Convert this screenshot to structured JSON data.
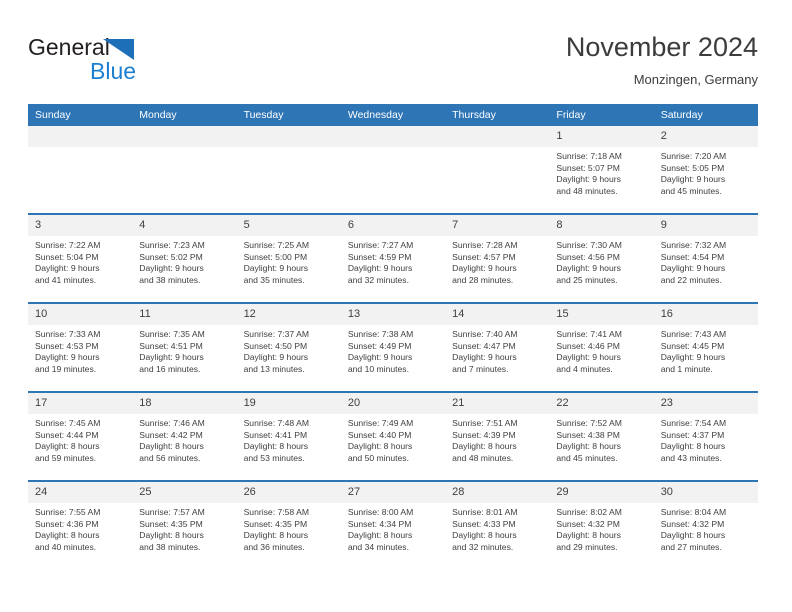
{
  "brand": {
    "word1": "General",
    "word2": "Blue",
    "mark": "triangle-icon",
    "colors": {
      "dark": "#231f20",
      "blue": "#1d7fd0",
      "mark": "#1d6fb8"
    }
  },
  "header": {
    "title": "November 2024",
    "subtitle": "Monzingen, Germany"
  },
  "theme": {
    "header_bg": "#2e75b6",
    "header_text": "#ffffff",
    "daynum_bg": "#f2f2f2",
    "body_text": "#404040",
    "row_divider": "#2e75b6"
  },
  "weekday_headers": [
    "Sunday",
    "Monday",
    "Tuesday",
    "Wednesday",
    "Thursday",
    "Friday",
    "Saturday"
  ],
  "labels": {
    "sunrise_prefix": "Sunrise: ",
    "sunset_prefix": "Sunset: ",
    "daylight_prefix": "Daylight: "
  },
  "weeks": [
    [
      {
        "day": "",
        "blank": true
      },
      {
        "day": "",
        "blank": true
      },
      {
        "day": "",
        "blank": true
      },
      {
        "day": "",
        "blank": true
      },
      {
        "day": "",
        "blank": true
      },
      {
        "day": "1",
        "sunrise": "Sunrise: 7:18 AM",
        "sunset": "Sunset: 5:07 PM",
        "daylight_l1": "Daylight: 9 hours",
        "daylight_l2": "and 48 minutes."
      },
      {
        "day": "2",
        "sunrise": "Sunrise: 7:20 AM",
        "sunset": "Sunset: 5:05 PM",
        "daylight_l1": "Daylight: 9 hours",
        "daylight_l2": "and 45 minutes."
      }
    ],
    [
      {
        "day": "3",
        "sunrise": "Sunrise: 7:22 AM",
        "sunset": "Sunset: 5:04 PM",
        "daylight_l1": "Daylight: 9 hours",
        "daylight_l2": "and 41 minutes."
      },
      {
        "day": "4",
        "sunrise": "Sunrise: 7:23 AM",
        "sunset": "Sunset: 5:02 PM",
        "daylight_l1": "Daylight: 9 hours",
        "daylight_l2": "and 38 minutes."
      },
      {
        "day": "5",
        "sunrise": "Sunrise: 7:25 AM",
        "sunset": "Sunset: 5:00 PM",
        "daylight_l1": "Daylight: 9 hours",
        "daylight_l2": "and 35 minutes."
      },
      {
        "day": "6",
        "sunrise": "Sunrise: 7:27 AM",
        "sunset": "Sunset: 4:59 PM",
        "daylight_l1": "Daylight: 9 hours",
        "daylight_l2": "and 32 minutes."
      },
      {
        "day": "7",
        "sunrise": "Sunrise: 7:28 AM",
        "sunset": "Sunset: 4:57 PM",
        "daylight_l1": "Daylight: 9 hours",
        "daylight_l2": "and 28 minutes."
      },
      {
        "day": "8",
        "sunrise": "Sunrise: 7:30 AM",
        "sunset": "Sunset: 4:56 PM",
        "daylight_l1": "Daylight: 9 hours",
        "daylight_l2": "and 25 minutes."
      },
      {
        "day": "9",
        "sunrise": "Sunrise: 7:32 AM",
        "sunset": "Sunset: 4:54 PM",
        "daylight_l1": "Daylight: 9 hours",
        "daylight_l2": "and 22 minutes."
      }
    ],
    [
      {
        "day": "10",
        "sunrise": "Sunrise: 7:33 AM",
        "sunset": "Sunset: 4:53 PM",
        "daylight_l1": "Daylight: 9 hours",
        "daylight_l2": "and 19 minutes."
      },
      {
        "day": "11",
        "sunrise": "Sunrise: 7:35 AM",
        "sunset": "Sunset: 4:51 PM",
        "daylight_l1": "Daylight: 9 hours",
        "daylight_l2": "and 16 minutes."
      },
      {
        "day": "12",
        "sunrise": "Sunrise: 7:37 AM",
        "sunset": "Sunset: 4:50 PM",
        "daylight_l1": "Daylight: 9 hours",
        "daylight_l2": "and 13 minutes."
      },
      {
        "day": "13",
        "sunrise": "Sunrise: 7:38 AM",
        "sunset": "Sunset: 4:49 PM",
        "daylight_l1": "Daylight: 9 hours",
        "daylight_l2": "and 10 minutes."
      },
      {
        "day": "14",
        "sunrise": "Sunrise: 7:40 AM",
        "sunset": "Sunset: 4:47 PM",
        "daylight_l1": "Daylight: 9 hours",
        "daylight_l2": "and 7 minutes."
      },
      {
        "day": "15",
        "sunrise": "Sunrise: 7:41 AM",
        "sunset": "Sunset: 4:46 PM",
        "daylight_l1": "Daylight: 9 hours",
        "daylight_l2": "and 4 minutes."
      },
      {
        "day": "16",
        "sunrise": "Sunrise: 7:43 AM",
        "sunset": "Sunset: 4:45 PM",
        "daylight_l1": "Daylight: 9 hours",
        "daylight_l2": "and 1 minute."
      }
    ],
    [
      {
        "day": "17",
        "sunrise": "Sunrise: 7:45 AM",
        "sunset": "Sunset: 4:44 PM",
        "daylight_l1": "Daylight: 8 hours",
        "daylight_l2": "and 59 minutes."
      },
      {
        "day": "18",
        "sunrise": "Sunrise: 7:46 AM",
        "sunset": "Sunset: 4:42 PM",
        "daylight_l1": "Daylight: 8 hours",
        "daylight_l2": "and 56 minutes."
      },
      {
        "day": "19",
        "sunrise": "Sunrise: 7:48 AM",
        "sunset": "Sunset: 4:41 PM",
        "daylight_l1": "Daylight: 8 hours",
        "daylight_l2": "and 53 minutes."
      },
      {
        "day": "20",
        "sunrise": "Sunrise: 7:49 AM",
        "sunset": "Sunset: 4:40 PM",
        "daylight_l1": "Daylight: 8 hours",
        "daylight_l2": "and 50 minutes."
      },
      {
        "day": "21",
        "sunrise": "Sunrise: 7:51 AM",
        "sunset": "Sunset: 4:39 PM",
        "daylight_l1": "Daylight: 8 hours",
        "daylight_l2": "and 48 minutes."
      },
      {
        "day": "22",
        "sunrise": "Sunrise: 7:52 AM",
        "sunset": "Sunset: 4:38 PM",
        "daylight_l1": "Daylight: 8 hours",
        "daylight_l2": "and 45 minutes."
      },
      {
        "day": "23",
        "sunrise": "Sunrise: 7:54 AM",
        "sunset": "Sunset: 4:37 PM",
        "daylight_l1": "Daylight: 8 hours",
        "daylight_l2": "and 43 minutes."
      }
    ],
    [
      {
        "day": "24",
        "sunrise": "Sunrise: 7:55 AM",
        "sunset": "Sunset: 4:36 PM",
        "daylight_l1": "Daylight: 8 hours",
        "daylight_l2": "and 40 minutes."
      },
      {
        "day": "25",
        "sunrise": "Sunrise: 7:57 AM",
        "sunset": "Sunset: 4:35 PM",
        "daylight_l1": "Daylight: 8 hours",
        "daylight_l2": "and 38 minutes."
      },
      {
        "day": "26",
        "sunrise": "Sunrise: 7:58 AM",
        "sunset": "Sunset: 4:35 PM",
        "daylight_l1": "Daylight: 8 hours",
        "daylight_l2": "and 36 minutes."
      },
      {
        "day": "27",
        "sunrise": "Sunrise: 8:00 AM",
        "sunset": "Sunset: 4:34 PM",
        "daylight_l1": "Daylight: 8 hours",
        "daylight_l2": "and 34 minutes."
      },
      {
        "day": "28",
        "sunrise": "Sunrise: 8:01 AM",
        "sunset": "Sunset: 4:33 PM",
        "daylight_l1": "Daylight: 8 hours",
        "daylight_l2": "and 32 minutes."
      },
      {
        "day": "29",
        "sunrise": "Sunrise: 8:02 AM",
        "sunset": "Sunset: 4:32 PM",
        "daylight_l1": "Daylight: 8 hours",
        "daylight_l2": "and 29 minutes."
      },
      {
        "day": "30",
        "sunrise": "Sunrise: 8:04 AM",
        "sunset": "Sunset: 4:32 PM",
        "daylight_l1": "Daylight: 8 hours",
        "daylight_l2": "and 27 minutes."
      }
    ]
  ]
}
